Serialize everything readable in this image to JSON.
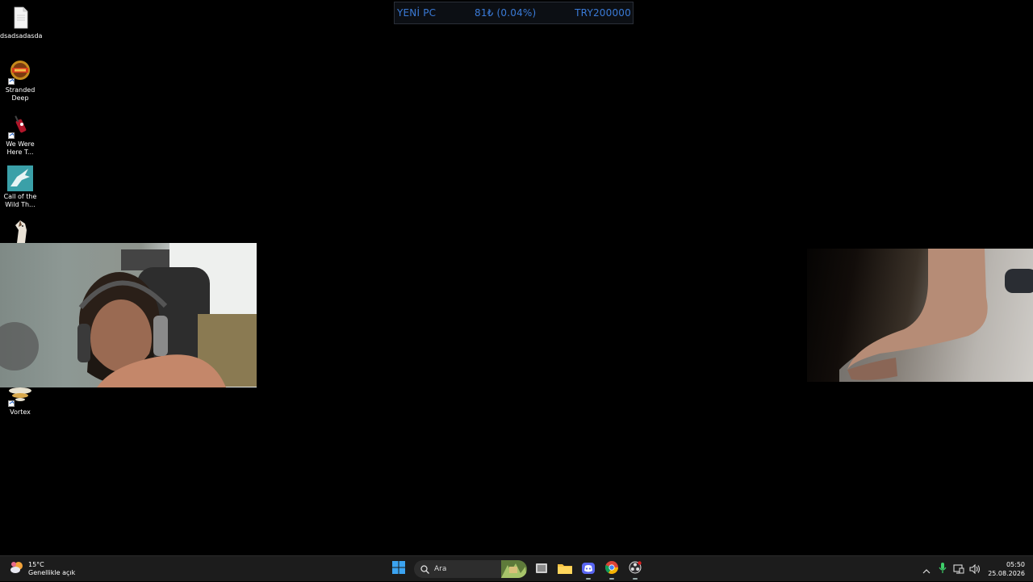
{
  "donation": {
    "label": "YENİ PC",
    "amount": "81₺ (0.04%)",
    "goal": "TRY200000",
    "text_color": "#3a7ad6"
  },
  "desktop_icons": [
    {
      "label": "dsadsadasda",
      "icon": "text-file-icon"
    },
    {
      "label": "Stranded Deep",
      "icon": "stranded-deep-icon"
    },
    {
      "label": "We Were Here T...",
      "icon": "we-were-here-icon"
    },
    {
      "label": "Call of the Wild Th...",
      "icon": "call-of-the-wild-icon"
    },
    {
      "label": "",
      "icon": "horse-game-icon"
    },
    {
      "label": "Vortex",
      "icon": "vortex-icon"
    }
  ],
  "taskbar": {
    "weather": {
      "temp": "15°C",
      "condition": "Genellikle açık",
      "icon": "weather-sun-cloud-icon"
    },
    "search_placeholder": "Ara",
    "apps": [
      "windows-start-icon",
      "task-view-icon",
      "file-explorer-icon",
      "discord-icon",
      "chrome-icon",
      "obs-icon"
    ],
    "tray_icons": [
      "chevron-up-icon",
      "microphone-icon",
      "network-icon",
      "volume-icon"
    ],
    "clock": {
      "time": "05:50",
      "date": "25.08.2026"
    }
  }
}
